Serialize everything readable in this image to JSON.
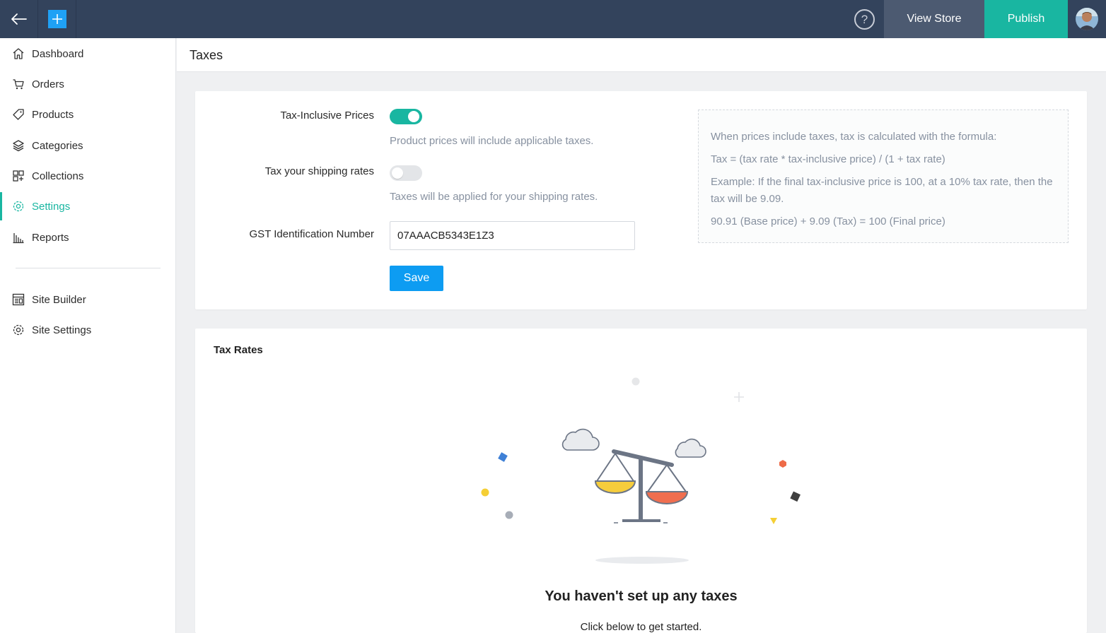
{
  "topbar": {
    "help_glyph": "?",
    "view_store_label": "View Store",
    "publish_label": "Publish"
  },
  "sidebar": {
    "items": [
      {
        "label": "Dashboard",
        "icon": "home-icon"
      },
      {
        "label": "Orders",
        "icon": "cart-icon"
      },
      {
        "label": "Products",
        "icon": "tag-icon"
      },
      {
        "label": "Categories",
        "icon": "layers-icon"
      },
      {
        "label": "Collections",
        "icon": "grid-plus-icon"
      },
      {
        "label": "Settings",
        "icon": "gear-icon",
        "active": true
      },
      {
        "label": "Reports",
        "icon": "bar-chart-icon"
      }
    ],
    "secondary_items": [
      {
        "label": "Site Builder",
        "icon": "layout-icon"
      },
      {
        "label": "Site Settings",
        "icon": "gear-icon"
      }
    ]
  },
  "page": {
    "title": "Taxes"
  },
  "tax_settings": {
    "tax_inclusive": {
      "label": "Tax-Inclusive Prices",
      "hint": "Product prices will include applicable taxes.",
      "enabled": true
    },
    "tax_shipping": {
      "label": "Tax your shipping rates",
      "hint": "Taxes will be applied for your shipping rates.",
      "enabled": false
    },
    "gst": {
      "label": "GST Identification Number",
      "value": "07AAACB5343E1Z3"
    },
    "save_label": "Save"
  },
  "formula": {
    "line1": "When prices include taxes, tax is calculated with the formula:",
    "line2": "Tax = (tax rate * tax-inclusive price) / (1 + tax rate)",
    "line3": "Example: If the final tax-inclusive price is 100, at a 10% tax rate, then the tax will be 9.09.",
    "line4": "90.91 (Base price) + 9.09 (Tax) = 100 (Final price)"
  },
  "tax_rates": {
    "heading": "Tax Rates",
    "empty_title": "You haven't set up any taxes",
    "empty_subtitle": "Click below to get started."
  },
  "colors": {
    "accent": "#19b6a1",
    "topbar": "#33435c",
    "primary_button": "#0d9cf2"
  }
}
